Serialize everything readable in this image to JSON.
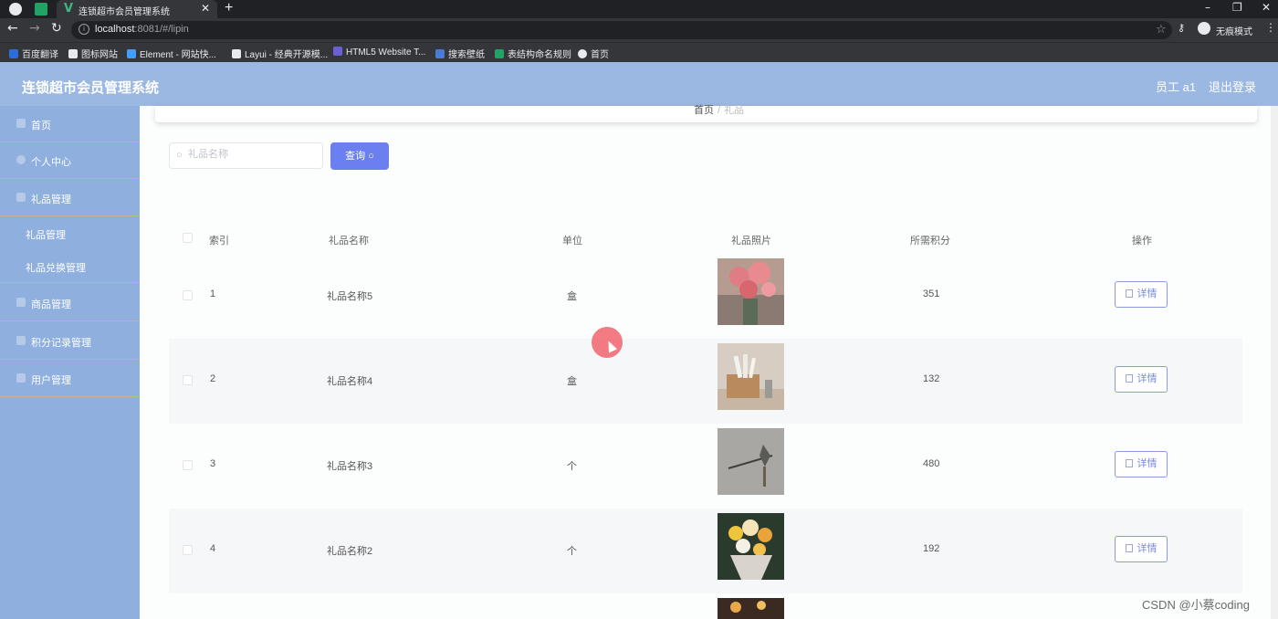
{
  "browser": {
    "tab_title": "连锁超市会员管理系统",
    "tab_close": "✕",
    "new_tab": "+",
    "url_host": "localhost",
    "url_path": ":8081/#/lipin",
    "incognito_label": "无痕模式",
    "bookmarks": [
      {
        "label": "百度翻译",
        "color": "#2d6cdf"
      },
      {
        "label": "图标网站",
        "color": "#e8eaed"
      },
      {
        "label": "Element - 网站快...",
        "color": "#409eff"
      },
      {
        "label": "Layui - 经典开源模...",
        "color": "#e8eaed"
      },
      {
        "label": "HTML5 Website T...",
        "color": "#6b5fd6"
      },
      {
        "label": "搜索壁纸",
        "color": "#4a7bd6"
      },
      {
        "label": "表结构命名规则",
        "color": "#21a366"
      },
      {
        "label": "首页",
        "color": "#e8eaed"
      }
    ]
  },
  "header": {
    "title": "连锁超市会员管理系统",
    "user": "员工 a1",
    "logout": "退出登录"
  },
  "sidebar": {
    "items": [
      {
        "label": "首页",
        "icon": "home-icon"
      },
      {
        "label": "个人中心",
        "icon": "user-icon"
      },
      {
        "label": "礼品管理",
        "icon": "gift-icon"
      },
      {
        "label": "礼品管理",
        "sub": true
      },
      {
        "label": "礼品兑换管理",
        "sub": true
      },
      {
        "label": "商品管理",
        "icon": "goods-icon"
      },
      {
        "label": "积分记录管理",
        "icon": "points-icon"
      },
      {
        "label": "用户管理",
        "icon": "users-icon"
      }
    ]
  },
  "breadcrumb": {
    "home": "首页",
    "sep": "/",
    "current": "礼品"
  },
  "search": {
    "placeholder": "礼品名称",
    "button": "查询"
  },
  "table": {
    "headers": [
      "索引",
      "礼品名称",
      "单位",
      "礼品照片",
      "所需积分",
      "操作"
    ],
    "detail_label": "详情",
    "rows": [
      {
        "index": "1",
        "name": "礼品名称5",
        "unit": "盒",
        "points": "351",
        "photo": "pink-flowers-photo"
      },
      {
        "index": "2",
        "name": "礼品名称4",
        "unit": "盒",
        "points": "132",
        "photo": "pens-holder-photo"
      },
      {
        "index": "3",
        "name": "礼品名称3",
        "unit": "个",
        "points": "480",
        "photo": "metal-ornament-photo"
      },
      {
        "index": "4",
        "name": "礼品名称2",
        "unit": "个",
        "points": "192",
        "photo": "bouquet-photo"
      }
    ]
  },
  "watermark": "CSDN @小蔡coding"
}
